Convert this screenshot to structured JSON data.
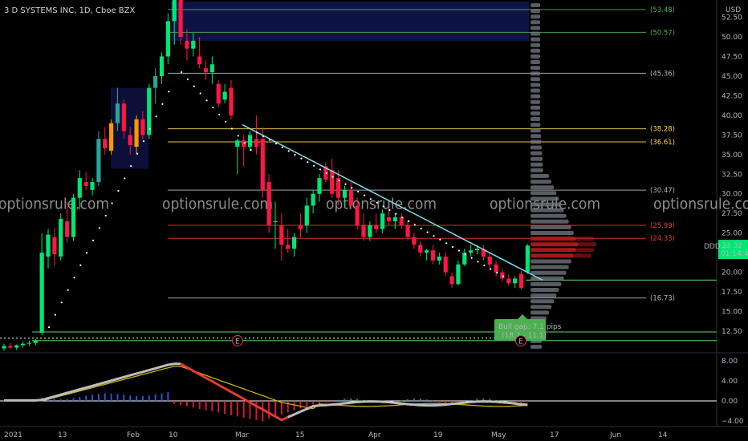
{
  "header": {
    "title": "3 D SYSTEMS INC, 1D, Cboe BZX",
    "currency": "USD"
  },
  "watermark": "optionsrule.com",
  "colors": {
    "up": "#26a69a",
    "up_bright": "#00e676",
    "down": "#ff1744",
    "orange": "#ff9800",
    "level_gray": "#b2b5be",
    "level_yellow": "#ffd54f",
    "level_red": "#e53935",
    "level_green": "#4caf50",
    "trend": "#80deea",
    "zone": "#1a237e",
    "macd": "#bdbdbd",
    "signal": "#c8b400",
    "pane_line": "#ffffff"
  },
  "chart_data": {
    "type": "candlestick",
    "symbol": "DDD",
    "price_axis": {
      "min": 10,
      "max": 55,
      "ticks": [
        12.5,
        15,
        17.5,
        20,
        22.5,
        25,
        27.5,
        30,
        32.5,
        35,
        37.5,
        40,
        42.5,
        45,
        47.5,
        50,
        52.5
      ]
    },
    "x_axis": {
      "labels": [
        "2021",
        "13",
        "Feb",
        "10",
        "Mar",
        "15",
        "Apr",
        "19",
        "May",
        "17",
        "Jun",
        "14"
      ]
    },
    "current_price": {
      "label": "DDD",
      "value": "23.32",
      "countdown": "01:14:48"
    },
    "levels": [
      {
        "value": 53.48,
        "label": "(53.48)",
        "color": "level_green"
      },
      {
        "value": 50.57,
        "label": "(50.57)",
        "color": "level_green"
      },
      {
        "value": 45.36,
        "label": "(45.36)",
        "color": "level_gray"
      },
      {
        "value": 38.28,
        "label": "(38.28)",
        "color": "level_yellow"
      },
      {
        "value": 36.61,
        "label": "(36.61)",
        "color": "level_yellow"
      },
      {
        "value": 30.47,
        "label": "(30.47)",
        "color": "level_gray"
      },
      {
        "value": 25.99,
        "label": "(25.99)",
        "color": "level_red"
      },
      {
        "value": 24.33,
        "label": "(24.33)",
        "color": "level_red"
      },
      {
        "value": 16.73,
        "label": "(16.73)",
        "color": "level_gray"
      }
    ],
    "green_lines": [
      19.0,
      12.4,
      11.3
    ],
    "annotation": {
      "line1": "Bull gap: 7.1 pips",
      "line2": "(18.2 - 11.1)"
    },
    "earnings_markers": [
      "E",
      "E"
    ],
    "macd": {
      "ticks": [
        8.0,
        4.0,
        0.0,
        -4.0
      ],
      "labels": [
        "8.00",
        "4.00",
        "0.00",
        "−4.00"
      ],
      "min": -4.6,
      "max": 9.2
    },
    "candles": [
      [
        10.3,
        10.9,
        10.0,
        10.6
      ],
      [
        10.6,
        11.0,
        10.2,
        10.4
      ],
      [
        10.4,
        10.8,
        10.1,
        10.7
      ],
      [
        10.7,
        11.2,
        10.4,
        10.9
      ],
      [
        10.9,
        11.3,
        10.6,
        11.0
      ],
      [
        11.0,
        11.5,
        10.7,
        11.3
      ],
      [
        12.3,
        25.0,
        12.0,
        22.5
      ],
      [
        22.0,
        25.5,
        20.5,
        24.8
      ],
      [
        24.5,
        25.6,
        20.8,
        22.3
      ],
      [
        22.0,
        27.5,
        21.5,
        26.8
      ],
      [
        26.5,
        29.0,
        23.8,
        24.5
      ],
      [
        24.5,
        30.0,
        24.0,
        29.5
      ],
      [
        29.5,
        33.0,
        28.0,
        32.0
      ],
      [
        31.5,
        32.8,
        30.5,
        31.0
      ],
      [
        30.5,
        32.0,
        29.8,
        31.5
      ],
      [
        31.5,
        38.0,
        31.0,
        37.0
      ],
      [
        37.0,
        38.5,
        35.0,
        35.8
      ],
      [
        35.5,
        39.5,
        35.0,
        39.0
      ],
      [
        39.0,
        43.5,
        38.0,
        41.5
      ],
      [
        41.5,
        42.0,
        37.0,
        38.0
      ],
      [
        37.5,
        38.5,
        35.0,
        36.2
      ],
      [
        36.0,
        40.0,
        35.0,
        39.5
      ],
      [
        39.5,
        40.5,
        37.0,
        37.5
      ],
      [
        37.5,
        44.0,
        37.0,
        43.5
      ],
      [
        43.5,
        46.0,
        41.5,
        45.0
      ],
      [
        45.0,
        48.0,
        44.0,
        47.5
      ],
      [
        47.5,
        53.0,
        46.5,
        52.0
      ],
      [
        52.0,
        56.0,
        49.0,
        55.0
      ],
      [
        55.0,
        56.0,
        49.0,
        50.0
      ],
      [
        49.5,
        51.0,
        47.0,
        48.5
      ],
      [
        48.5,
        50.5,
        47.5,
        49.5
      ],
      [
        47.5,
        50.0,
        46.0,
        46.5
      ],
      [
        46.0,
        47.0,
        44.5,
        45.5
      ],
      [
        45.5,
        47.5,
        44.0,
        46.5
      ],
      [
        44.0,
        44.5,
        41.0,
        41.5
      ],
      [
        42.0,
        44.0,
        41.5,
        43.0
      ],
      [
        43.5,
        44.5,
        39.5,
        40.0
      ],
      [
        36.0,
        37.0,
        32.5,
        36.8
      ],
      [
        36.8,
        37.5,
        33.5,
        36.0
      ],
      [
        36.0,
        38.0,
        35.5,
        37.5
      ],
      [
        37.0,
        40.0,
        35.0,
        36.0
      ],
      [
        37.0,
        38.5,
        29.5,
        30.5
      ],
      [
        31.5,
        32.5,
        25.0,
        26.0
      ],
      [
        26.5,
        29.0,
        23.0,
        26.5
      ],
      [
        26.0,
        27.5,
        21.5,
        23.5
      ],
      [
        23.5,
        25.5,
        22.5,
        23.0
      ],
      [
        23.0,
        25.0,
        22.0,
        24.5
      ],
      [
        26.0,
        27.5,
        24.5,
        25.5
      ],
      [
        26.0,
        29.5,
        25.0,
        28.5
      ],
      [
        28.5,
        30.5,
        27.5,
        30.0
      ],
      [
        30.0,
        32.5,
        29.0,
        32.0
      ],
      [
        33.5,
        34.0,
        31.5,
        31.8
      ],
      [
        33.0,
        34.5,
        29.5,
        30.0
      ],
      [
        32.0,
        33.0,
        28.5,
        29.5
      ],
      [
        29.5,
        31.0,
        28.5,
        30.5
      ],
      [
        30.5,
        31.5,
        28.0,
        28.5
      ],
      [
        28.5,
        29.5,
        25.5,
        26.0
      ],
      [
        26.0,
        27.5,
        24.0,
        24.5
      ],
      [
        24.5,
        26.5,
        24.0,
        26.0
      ],
      [
        26.0,
        27.5,
        25.0,
        25.5
      ],
      [
        25.5,
        28.0,
        25.0,
        27.5
      ],
      [
        27.0,
        28.0,
        26.0,
        26.5
      ],
      [
        26.5,
        27.5,
        25.5,
        27.0
      ],
      [
        27.0,
        27.5,
        25.5,
        26.0
      ],
      [
        26.0,
        26.5,
        24.0,
        24.5
      ],
      [
        24.5,
        25.0,
        23.0,
        23.5
      ],
      [
        23.5,
        24.0,
        22.0,
        22.5
      ],
      [
        22.5,
        23.0,
        21.5,
        22.8
      ],
      [
        22.8,
        23.5,
        21.0,
        21.5
      ],
      [
        21.5,
        22.5,
        21.0,
        22.0
      ],
      [
        22.0,
        22.5,
        19.5,
        20.0
      ],
      [
        19.5,
        20.0,
        18.0,
        18.5
      ],
      [
        18.5,
        21.5,
        18.3,
        21.0
      ],
      [
        21.0,
        23.0,
        20.8,
        22.5
      ],
      [
        22.5,
        23.5,
        22.0,
        22.8
      ],
      [
        22.8,
        23.5,
        22.3,
        23.0
      ],
      [
        23.0,
        23.5,
        21.5,
        22.0
      ],
      [
        22.0,
        22.5,
        20.5,
        21.0
      ],
      [
        21.0,
        21.5,
        19.5,
        20.0
      ],
      [
        20.0,
        20.5,
        18.8,
        19.2
      ],
      [
        19.2,
        19.8,
        18.3,
        18.6
      ],
      [
        18.6,
        19.5,
        18.0,
        19.2
      ],
      [
        19.8,
        20.2,
        17.8,
        18.0
      ],
      [
        20.0,
        23.6,
        19.8,
        23.4
      ]
    ]
  }
}
